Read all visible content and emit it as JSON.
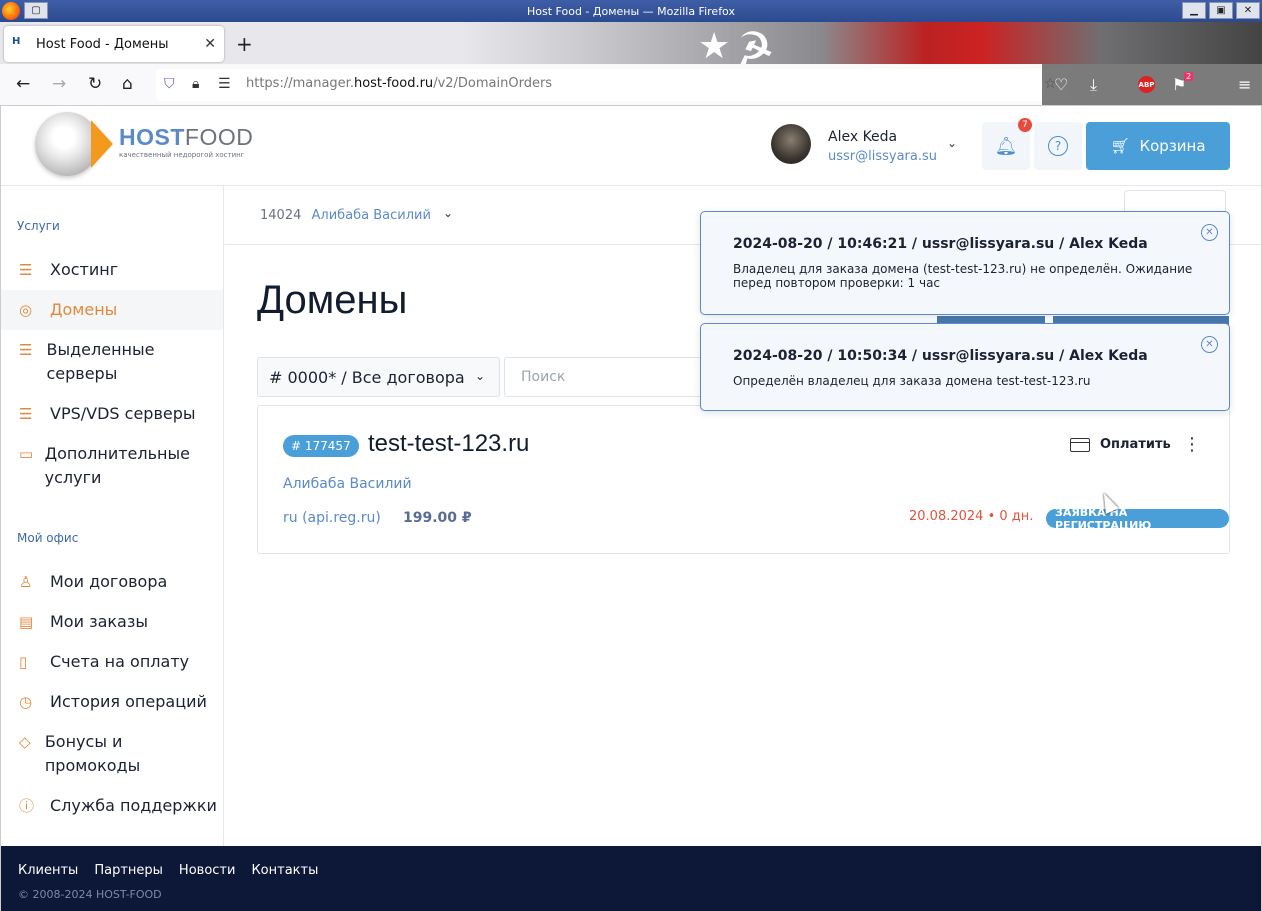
{
  "window": {
    "title": "Host Food - Домены — Mozilla Firefox"
  },
  "browser": {
    "tab_label": "Host Food - Домены",
    "url_prefix": "https://manager.",
    "url_domain": "host-food.ru",
    "url_path": "/v2/DomainOrders",
    "abp_label": "ABP",
    "ext_badge": "2"
  },
  "header": {
    "logo_host": "HOST",
    "logo_food": "FOOD",
    "logo_tagline": "качественный недорогой хостинг",
    "user_name": "Alex Keda",
    "user_email": "ussr@lissyara.su",
    "notifications_count": "7",
    "cart_label": "Корзина"
  },
  "sidebar": {
    "section_services": "Услуги",
    "services": [
      {
        "label": "Хостинг",
        "icon": "server-stack-icon"
      },
      {
        "label": "Домены",
        "icon": "globe-icon"
      },
      {
        "label": "Выделенные серверы",
        "icon": "rack-icon"
      },
      {
        "label": "VPS/VDS серверы",
        "icon": "vps-icon"
      },
      {
        "label": "Дополнительные услуги",
        "icon": "addons-icon"
      }
    ],
    "section_office": "Мой офис",
    "office": [
      {
        "label": "Мои договора",
        "icon": "contracts-icon"
      },
      {
        "label": "Мои заказы",
        "icon": "orders-icon"
      },
      {
        "label": "Счета на оплату",
        "icon": "invoice-icon"
      },
      {
        "label": "История операций",
        "icon": "history-icon"
      },
      {
        "label": "Бонусы и промокоды",
        "icon": "tag-icon"
      },
      {
        "label": "Служба поддержки",
        "icon": "support-icon"
      }
    ]
  },
  "breadcrumb": {
    "contract_id": "14024",
    "contract_name": "Алибаба Василий"
  },
  "main": {
    "title": "Домены",
    "filter_select": "# 0000* / Все договора",
    "search_placeholder": "Поиск"
  },
  "order": {
    "id_badge": "# 177457",
    "domain": "test-test-123.ru",
    "owner": "Алибаба Василий",
    "zone": "ru (api.reg.ru)",
    "price": "199.00 ₽",
    "pay_label": "Оплатить",
    "date": "20.08.2024",
    "days": "0 дн.",
    "status": "ЗАЯВКА НА РЕГИСТРАЦИЮ"
  },
  "toasts": [
    {
      "header": "2024-08-20 / 10:46:21 / ussr@lissyara.su / Alex Keda",
      "body": "Владелец для заказа домена (test-test-123.ru) не определён. Ожидание перед повтором проверки: 1 час"
    },
    {
      "header": "2024-08-20 / 10:50:34 / ussr@lissyara.su / Alex Keda",
      "body": "Определён владелец для заказа домена test-test-123.ru"
    }
  ],
  "footer": {
    "links": [
      "Клиенты",
      "Партнеры",
      "Новости",
      "Контакты"
    ],
    "copyright": "© 2008-2024 HOST-FOOD"
  },
  "colors": {
    "accent": "#4a9fd8",
    "link": "#5b8ac9",
    "orange": "#e28a3c",
    "date_red": "#e0533f",
    "footer_bg": "#0d1738"
  }
}
